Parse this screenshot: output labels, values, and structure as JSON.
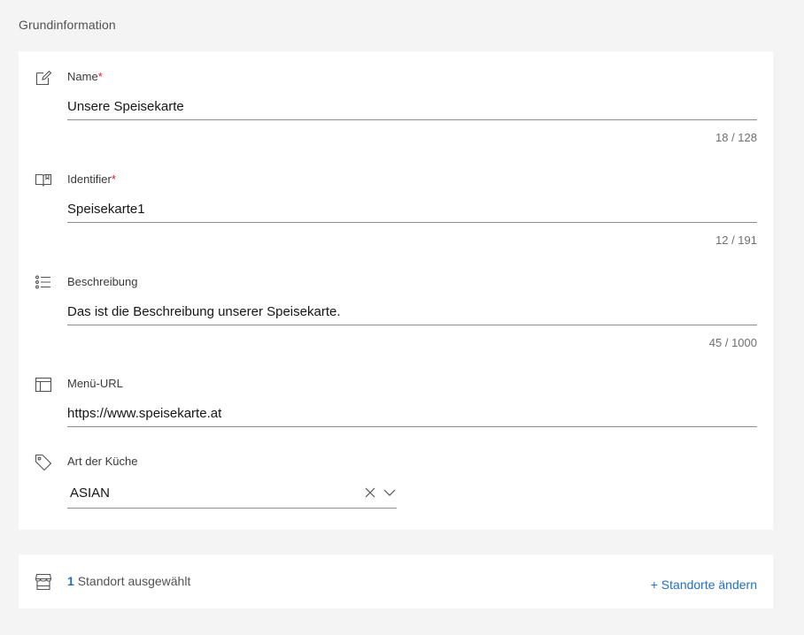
{
  "section": {
    "title": "Grundinformation"
  },
  "fields": {
    "name": {
      "label": "Name",
      "required_mark": "*",
      "value": "Unsere Speisekarte",
      "counter": "18 / 128",
      "icon": "edit-icon"
    },
    "identifier": {
      "label": "Identifier",
      "required_mark": "*",
      "value": "Speisekarte1",
      "counter": "12 / 191",
      "icon": "book-icon"
    },
    "description": {
      "label": "Beschreibung",
      "value": "Das ist die Beschreibung unserer Speisekarte.",
      "counter": "45 / 1000",
      "icon": "list-icon"
    },
    "menu_url": {
      "label": "Menü-URL",
      "value": "https://www.speisekarte.at",
      "icon": "layout-icon"
    },
    "cuisine": {
      "label": "Art der Küche",
      "value": "ASIAN",
      "icon": "tag-icon"
    }
  },
  "locations": {
    "count": "1",
    "text": "Standort ausgewählt",
    "link": "+ Standorte ändern",
    "icon": "store-icon"
  },
  "colors": {
    "background": "#f4f4f4",
    "card": "#ffffff",
    "required": "#da1e28",
    "link": "#1f70c1"
  }
}
